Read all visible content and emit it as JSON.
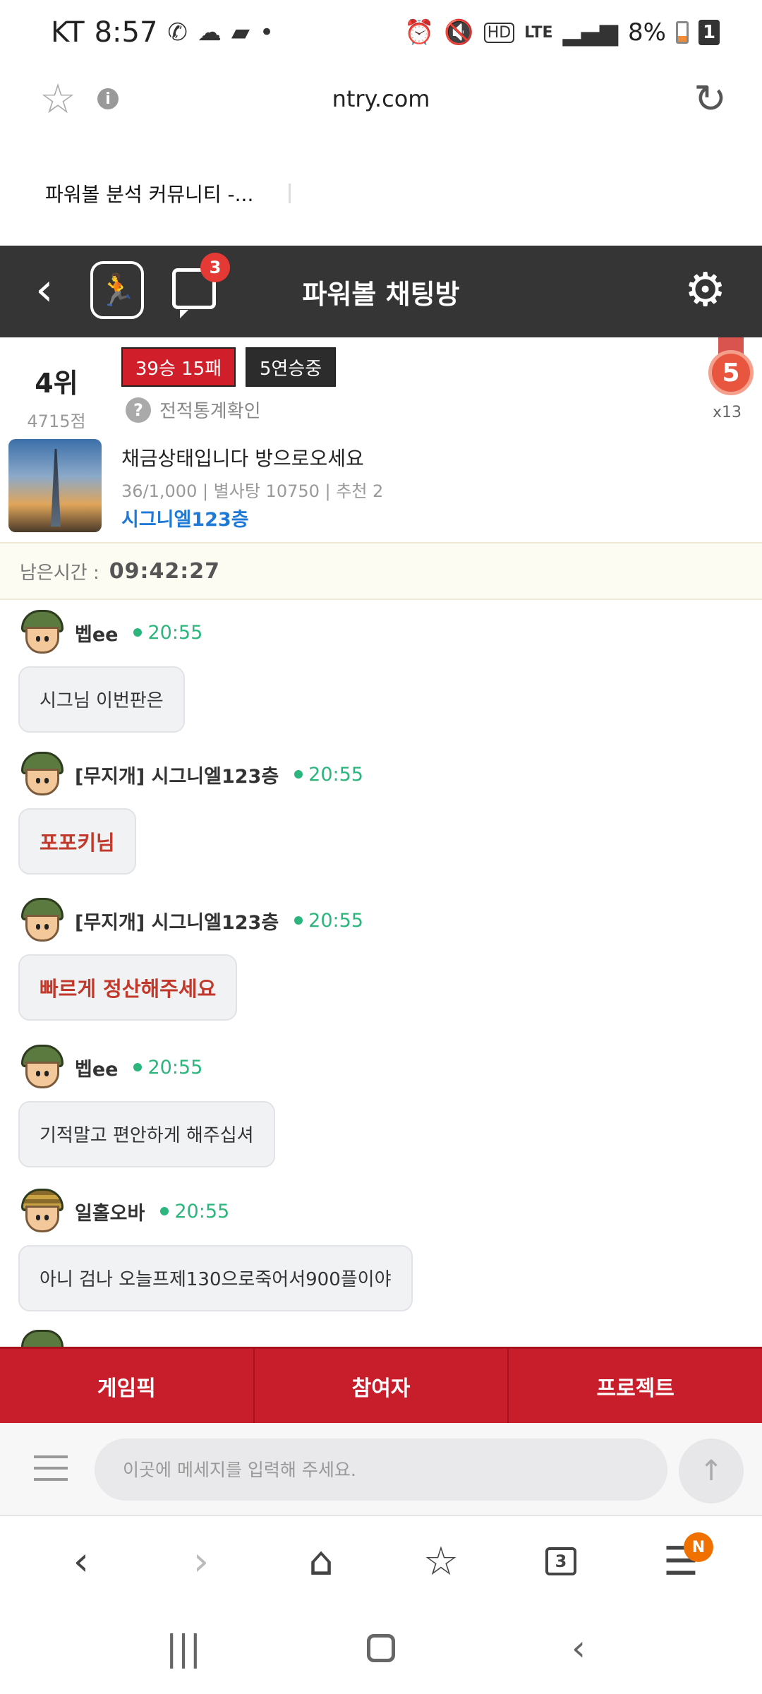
{
  "status_bar": {
    "carrier": "KT",
    "time": "8:57",
    "battery_percent": "8%",
    "notification_count": "1"
  },
  "browser": {
    "url": "ntry.com",
    "tab_title": "파워볼 분석 커뮤니티 -..."
  },
  "app_header": {
    "title": "파워볼 채팅방",
    "chat_badge": "3"
  },
  "profile": {
    "rank": "4위",
    "points": "4715점",
    "record": "39승 15패",
    "streak": "5연승중",
    "stats_link": "전적통계확인",
    "medal_level": "5",
    "medal_count": "x13"
  },
  "room": {
    "title": "채금상태입니다 방으로오세요",
    "meta": "36/1,000 | 별사탕 10750 | 추천 2",
    "owner": "시그니엘123층"
  },
  "timer": {
    "label": "남은시간 :",
    "value": "09:42:27"
  },
  "messages": [
    {
      "nick": "벱ee",
      "time": "20:55",
      "text": "시그님 이번판은",
      "highlight": false
    },
    {
      "nick": "[무지개] 시그니엘123층",
      "time": "20:55",
      "text": "포포키님",
      "highlight": true
    },
    {
      "nick": "[무지개] 시그니엘123층",
      "time": "20:55",
      "text": "빠르게 정산해주세요",
      "highlight": true
    },
    {
      "nick": "벱ee",
      "time": "20:55",
      "text": "기적말고 편안하게 해주십셔",
      "highlight": false
    },
    {
      "nick": "일홀오바",
      "time": "20:55",
      "text": "아니 검나 오늘프제130으로죽어서900플이야",
      "highlight": false
    }
  ],
  "bottom_tabs": [
    "게임픽",
    "참여자",
    "프로젝트"
  ],
  "input": {
    "placeholder": "이곳에 메세지를 입력해 주세요."
  },
  "browser_nav": {
    "tab_count": "3",
    "menu_badge": "N"
  },
  "colors": {
    "header_bg": "#353535",
    "accent_red": "#c81e2b",
    "online_green": "#2cb67d",
    "owner_blue": "#1e7ad6"
  }
}
